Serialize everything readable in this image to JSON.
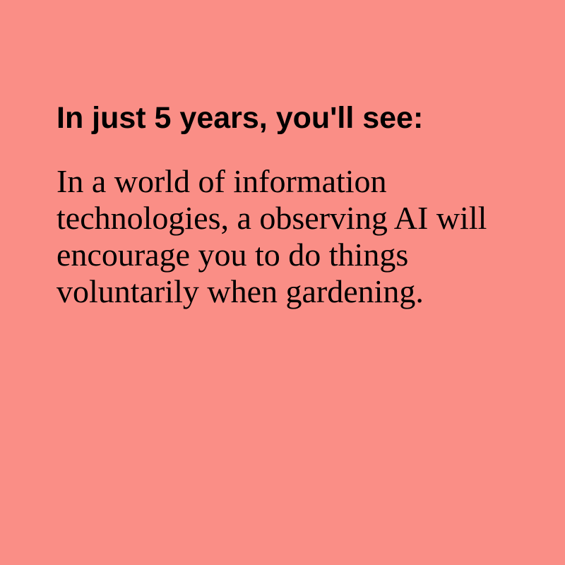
{
  "card": {
    "heading": "In just 5 years, you'll see:",
    "body": "In a world of information technologies, a observing AI will encourage you to do things voluntarily when gardening.",
    "background_color": "#fa8e86",
    "text_color": "#000000"
  }
}
